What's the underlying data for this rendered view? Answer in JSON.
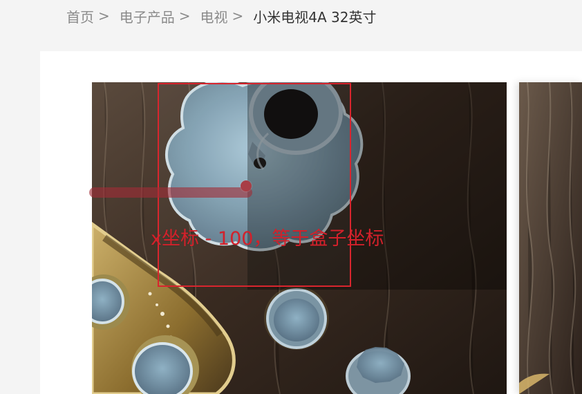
{
  "breadcrumb": {
    "items": [
      {
        "label": "首页"
      },
      {
        "label": "电子产品"
      },
      {
        "label": "电视"
      }
    ],
    "separator": ">",
    "current": "小米电视4A 32英寸"
  },
  "preview": {
    "annotation": "x坐标 - 100，等于盒子坐标"
  },
  "colors": {
    "accent": "#d9252e",
    "text_muted": "#8a8a8a",
    "text_dark": "#333333",
    "page_background": "#f4f4f4",
    "panel_background": "#ffffff"
  },
  "icons": {
    "separator_icon": "chevron-right-icon"
  }
}
